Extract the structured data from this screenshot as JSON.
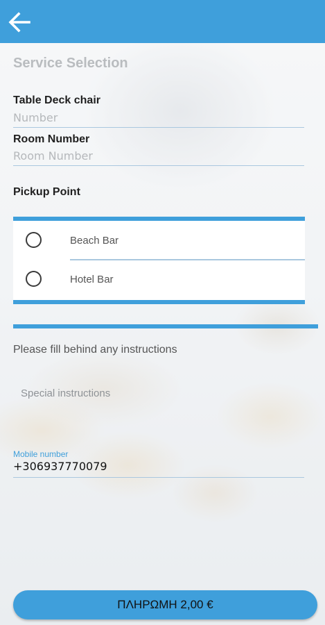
{
  "header": {
    "back_icon": "arrow-left-icon",
    "bar_color": "#3f9fdb"
  },
  "form": {
    "section_title": "Service Selection",
    "table_label": "Table Deck chair",
    "table_placeholder": "Number",
    "room_label": "Room Number",
    "room_placeholder": "Room Number",
    "pickup_label": "Pickup Point",
    "pickup_options": [
      "Beach Bar",
      "Hotel Bar"
    ],
    "instructions_label": "Please fill behind any instructions",
    "special_placeholder": "Special instructions",
    "mobile_label": "Mobile number",
    "mobile_value": "+306937770079"
  },
  "footer": {
    "pay_label": "ΠΛΗΡΩΜΗ 2,00 €"
  }
}
